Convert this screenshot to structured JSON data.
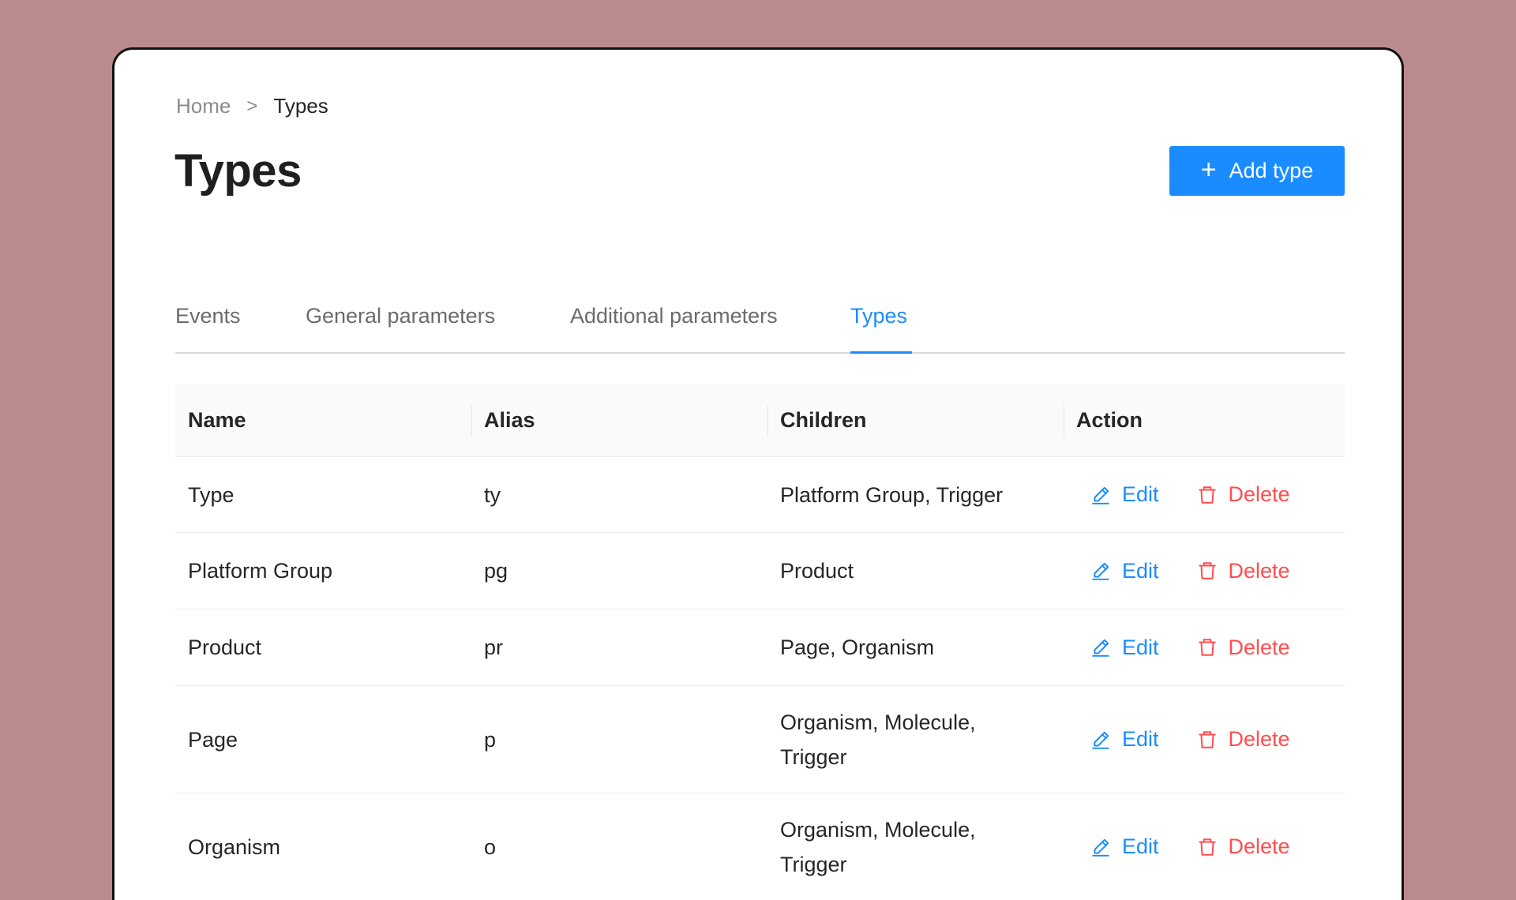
{
  "breadcrumb": {
    "home": "Home",
    "separator": ">",
    "current": "Types"
  },
  "page": {
    "title": "Types"
  },
  "add_button": {
    "label": "Add type",
    "icon": "plus-icon"
  },
  "tabs": [
    {
      "label": "Events",
      "active": false
    },
    {
      "label": "General parameters",
      "active": false
    },
    {
      "label": "Additional parameters",
      "active": false
    },
    {
      "label": "Types",
      "active": true
    }
  ],
  "table": {
    "columns": [
      "Name",
      "Alias",
      "Children",
      "Action"
    ],
    "rows": [
      {
        "name": "Type",
        "alias": "ty",
        "children": [
          "Platform Group, Trigger"
        ]
      },
      {
        "name": "Platform Group",
        "alias": "pg",
        "children": [
          "Product"
        ]
      },
      {
        "name": "Product",
        "alias": "pr",
        "children": [
          "Page, Organism"
        ]
      },
      {
        "name": "Page",
        "alias": "p",
        "children": [
          "Organism, Molecule,",
          "Trigger"
        ]
      },
      {
        "name": "Organism",
        "alias": "o",
        "children": [
          "Organism, Molecule,",
          "Trigger"
        ]
      }
    ],
    "edit_label": "Edit",
    "delete_label": "Delete"
  },
  "colors": {
    "accent": "#1a8cff",
    "danger": "#ff4d4f",
    "background": "#bb8a8f"
  }
}
